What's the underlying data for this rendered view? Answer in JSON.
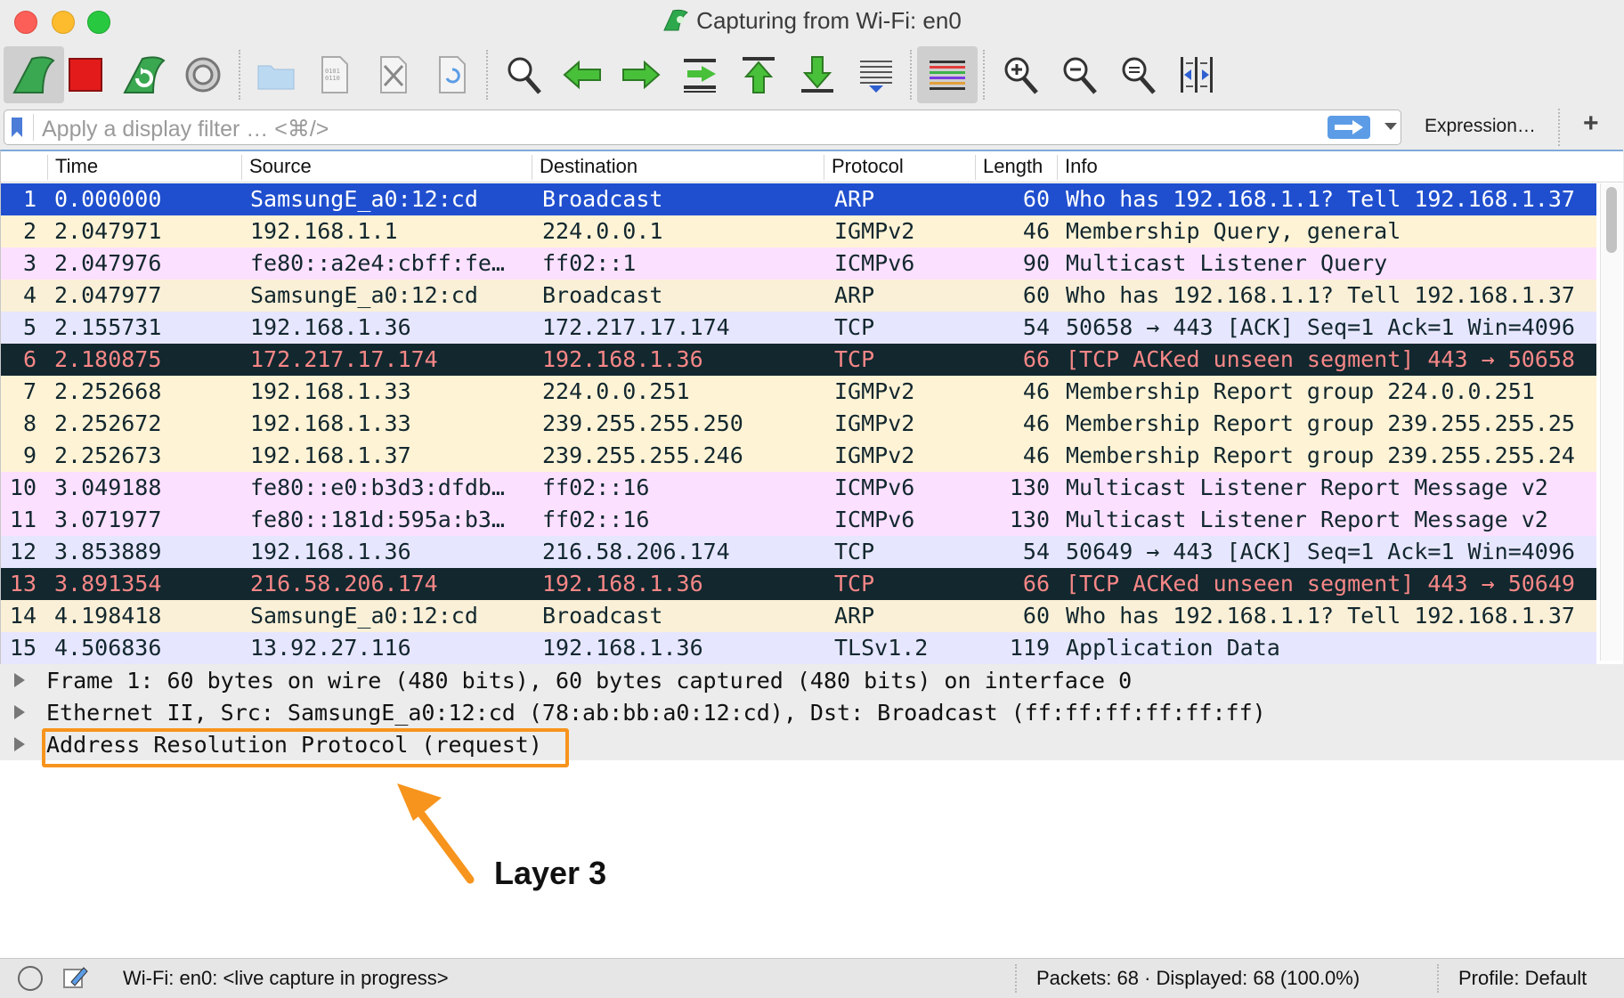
{
  "window": {
    "title": "Capturing from Wi-Fi: en0"
  },
  "toolbar": {
    "buttons": [
      {
        "name": "start-capture-fin-icon"
      },
      {
        "name": "stop-capture-icon"
      },
      {
        "name": "restart-capture-icon"
      },
      {
        "name": "capture-options-gear-icon"
      },
      {
        "name": "open-file-folder-icon"
      },
      {
        "name": "save-file-icon"
      },
      {
        "name": "close-file-icon"
      },
      {
        "name": "reload-file-icon"
      },
      {
        "name": "find-packet-search-icon"
      },
      {
        "name": "go-back-arrow-icon"
      },
      {
        "name": "go-forward-arrow-icon"
      },
      {
        "name": "go-to-packet-icon"
      },
      {
        "name": "go-first-packet-icon"
      },
      {
        "name": "go-last-packet-icon"
      },
      {
        "name": "autoscroll-icon"
      },
      {
        "name": "colorize-icon"
      },
      {
        "name": "zoom-in-icon"
      },
      {
        "name": "zoom-out-icon"
      },
      {
        "name": "normal-size-icon"
      },
      {
        "name": "resize-columns-icon"
      }
    ]
  },
  "filter": {
    "placeholder": "Apply a display filter … <⌘/>",
    "expression_label": "Expression…",
    "add_label": "+"
  },
  "columns": {
    "no": "",
    "time": "Time",
    "source": "Source",
    "destination": "Destination",
    "protocol": "Protocol",
    "length": "Length",
    "info": "Info"
  },
  "packets": [
    {
      "no": "1",
      "time": "0.000000",
      "src": "SamsungE_a0:12:cd",
      "dst": "Broadcast",
      "proto": "ARP",
      "len": "60",
      "info": "Who has 192.168.1.1? Tell 192.168.1.37",
      "bg": "#1f4fcf",
      "fg": "#ffffff"
    },
    {
      "no": "2",
      "time": "2.047971",
      "src": "192.168.1.1",
      "dst": "224.0.0.1",
      "proto": "IGMPv2",
      "len": "46",
      "info": "Membership Query, general",
      "bg": "#fff3d6",
      "fg": "#12272e"
    },
    {
      "no": "3",
      "time": "2.047976",
      "src": "fe80::a2e4:cbff:fe…",
      "dst": "ff02::1",
      "proto": "ICMPv6",
      "len": "90",
      "info": "Multicast Listener Query",
      "bg": "#fce0ff",
      "fg": "#12272e"
    },
    {
      "no": "4",
      "time": "2.047977",
      "src": "SamsungE_a0:12:cd",
      "dst": "Broadcast",
      "proto": "ARP",
      "len": "60",
      "info": "Who has 192.168.1.1? Tell 192.168.1.37",
      "bg": "#faf0d7",
      "fg": "#12272e"
    },
    {
      "no": "5",
      "time": "2.155731",
      "src": "192.168.1.36",
      "dst": "172.217.17.174",
      "proto": "TCP",
      "len": "54",
      "info": "50658 → 443 [ACK] Seq=1 Ack=1 Win=4096",
      "bg": "#e7e6ff",
      "fg": "#12272e"
    },
    {
      "no": "6",
      "time": "2.180875",
      "src": "172.217.17.174",
      "dst": "192.168.1.36",
      "proto": "TCP",
      "len": "66",
      "info": "[TCP ACKed unseen segment] 443 → 50658",
      "bg": "#12272e",
      "fg": "#f78787"
    },
    {
      "no": "7",
      "time": "2.252668",
      "src": "192.168.1.33",
      "dst": "224.0.0.251",
      "proto": "IGMPv2",
      "len": "46",
      "info": "Membership Report group 224.0.0.251",
      "bg": "#fff3d6",
      "fg": "#12272e"
    },
    {
      "no": "8",
      "time": "2.252672",
      "src": "192.168.1.33",
      "dst": "239.255.255.250",
      "proto": "IGMPv2",
      "len": "46",
      "info": "Membership Report group 239.255.255.25",
      "bg": "#fff3d6",
      "fg": "#12272e"
    },
    {
      "no": "9",
      "time": "2.252673",
      "src": "192.168.1.37",
      "dst": "239.255.255.246",
      "proto": "IGMPv2",
      "len": "46",
      "info": "Membership Report group 239.255.255.24",
      "bg": "#fff3d6",
      "fg": "#12272e"
    },
    {
      "no": "10",
      "time": "3.049188",
      "src": "fe80::e0:b3d3:dfdb…",
      "dst": "ff02::16",
      "proto": "ICMPv6",
      "len": "130",
      "info": "Multicast Listener Report Message v2",
      "bg": "#fce0ff",
      "fg": "#12272e"
    },
    {
      "no": "11",
      "time": "3.071977",
      "src": "fe80::181d:595a:b3…",
      "dst": "ff02::16",
      "proto": "ICMPv6",
      "len": "130",
      "info": "Multicast Listener Report Message v2",
      "bg": "#fce0ff",
      "fg": "#12272e"
    },
    {
      "no": "12",
      "time": "3.853889",
      "src": "192.168.1.36",
      "dst": "216.58.206.174",
      "proto": "TCP",
      "len": "54",
      "info": "50649 → 443 [ACK] Seq=1 Ack=1 Win=4096",
      "bg": "#e7e6ff",
      "fg": "#12272e"
    },
    {
      "no": "13",
      "time": "3.891354",
      "src": "216.58.206.174",
      "dst": "192.168.1.36",
      "proto": "TCP",
      "len": "66",
      "info": "[TCP ACKed unseen segment] 443 → 50649",
      "bg": "#12272e",
      "fg": "#f78787"
    },
    {
      "no": "14",
      "time": "4.198418",
      "src": "SamsungE_a0:12:cd",
      "dst": "Broadcast",
      "proto": "ARP",
      "len": "60",
      "info": "Who has 192.168.1.1? Tell 192.168.1.37",
      "bg": "#faf0d7",
      "fg": "#12272e"
    },
    {
      "no": "15",
      "time": "4.506836",
      "src": "13.92.27.116",
      "dst": "192.168.1.36",
      "proto": "TLSv1.2",
      "len": "119",
      "info": "Application Data",
      "bg": "#e7e6ff",
      "fg": "#12272e"
    }
  ],
  "details": [
    "Frame 1: 60 bytes on wire (480 bits), 60 bytes captured (480 bits) on interface 0",
    "Ethernet II, Src: SamsungE_a0:12:cd (78:ab:bb:a0:12:cd), Dst: Broadcast (ff:ff:ff:ff:ff:ff)",
    "Address Resolution Protocol (request)"
  ],
  "annotation": {
    "label": "Layer 3",
    "color": "#f7941d"
  },
  "status": {
    "capture": "Wi-Fi: en0: <live capture in progress>",
    "packets": "Packets: 68 · Displayed: 68 (100.0%)",
    "profile": "Profile: Default"
  }
}
